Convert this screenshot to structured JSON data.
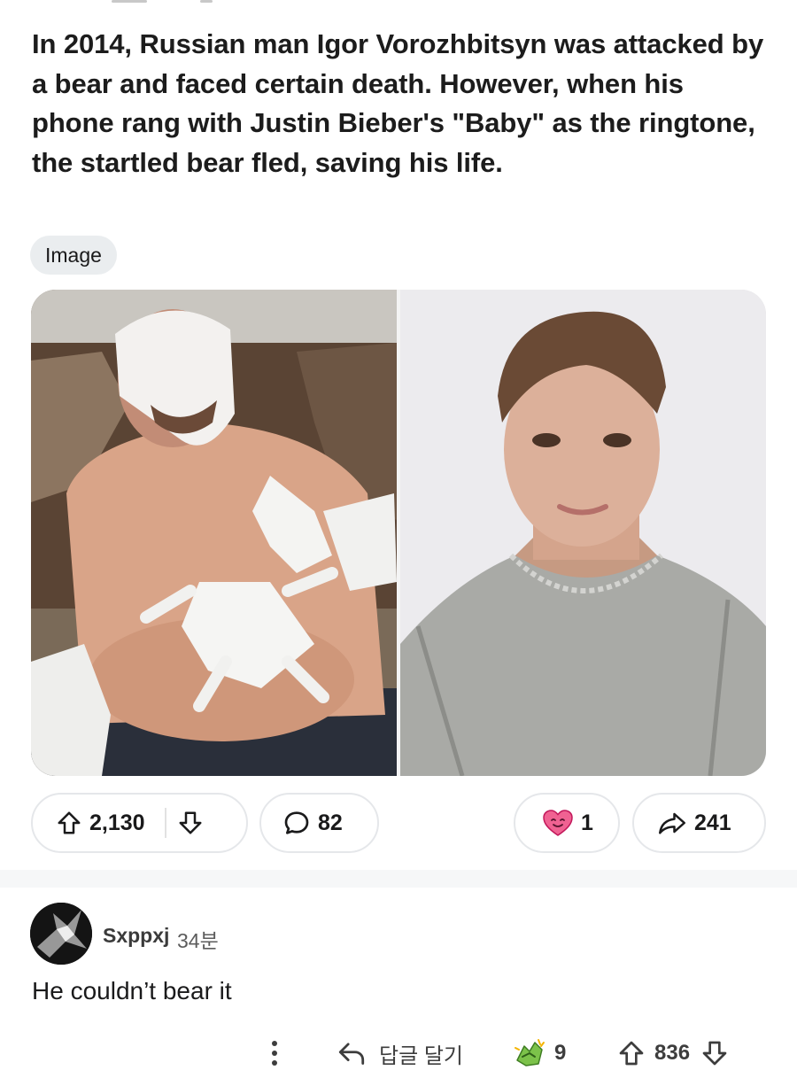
{
  "post": {
    "title": "In 2014, Russian man Igor Vorozhbitsyn was attacked by a bear and faced certain death. However, when his phone rang with Justin Bieber's \"Baby\" as the ringtone, the startled bear fled, saving his life.",
    "flair": "Image",
    "actions": {
      "score": "2,130",
      "comments": "82",
      "awards": "1",
      "shares": "241"
    }
  },
  "comment": {
    "author": "Sxppxj",
    "time": "34분",
    "body": "He couldn’t bear it",
    "actions": {
      "reply_label": "답글 달기",
      "awards": "9",
      "score": "836"
    }
  },
  "icons": {
    "upvote": "upvote-arrow-icon",
    "downvote": "downvote-arrow-icon",
    "comment": "speech-bubble-icon",
    "award": "heart-award-icon",
    "share": "share-arrow-icon",
    "more": "vertical-dots-icon",
    "reply": "reply-arrow-icon",
    "comment_award": "hands-award-icon"
  },
  "colors": {
    "pill_border": "#e5e7ea",
    "flair_bg": "#eaedef",
    "award_pink": "#f06292",
    "award_green": "#7cc24a"
  }
}
